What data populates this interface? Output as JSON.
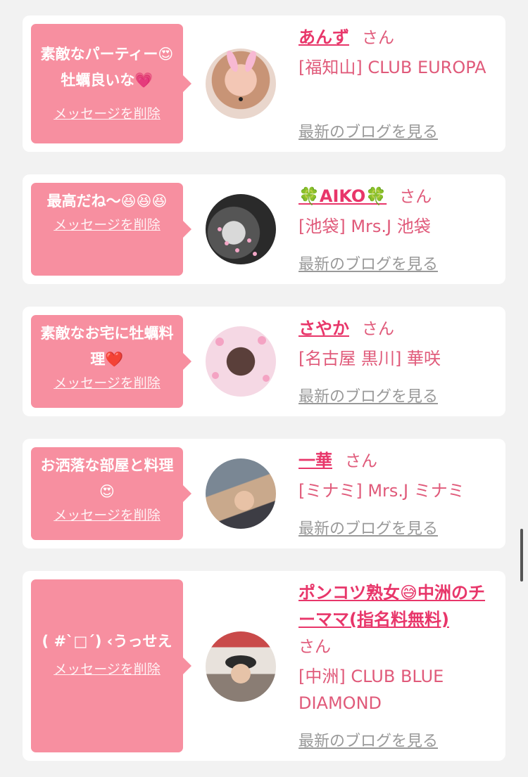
{
  "cards": [
    {
      "message": "素敵なパーティー😍牡蠣良いな💗",
      "delete_label": "メッセージを削除",
      "name": "あんず",
      "honorific": "さん",
      "shop": "[福知山] CLUB EUROPA",
      "blog_label": "最新のブログを見る"
    },
    {
      "message": "最高だね〜😆😆😆",
      "delete_label": "メッセージを削除",
      "name": "🍀AIKO🍀",
      "honorific": "さん",
      "shop": "[池袋] Mrs.J 池袋",
      "blog_label": "最新のブログを見る"
    },
    {
      "message": "素敵なお宅に牡蠣料理❤️",
      "delete_label": "メッセージを削除",
      "name": "さやか",
      "honorific": "さん",
      "shop": "[名古屋 黒川] 華咲",
      "blog_label": "最新のブログを見る"
    },
    {
      "message": "お洒落な部屋と料理😍",
      "delete_label": "メッセージを削除",
      "name": "一華",
      "honorific": "さん",
      "shop": "[ミナミ] Mrs.J ミナミ",
      "blog_label": "最新のブログを見る"
    },
    {
      "message": "( #`□´) ‹うっせえ",
      "delete_label": "メッセージを削除",
      "name": "ポンコツ熟女😅中洲のチーママ(指名料無料)",
      "honorific": "さん",
      "shop": "[中洲] CLUB BLUE DIAMOND",
      "blog_label": "最新のブログを見る"
    }
  ],
  "colors": {
    "bubble": "#f78fa0",
    "name": "#e8366a",
    "shop": "#e05a7a",
    "background": "#f2f2f2"
  }
}
